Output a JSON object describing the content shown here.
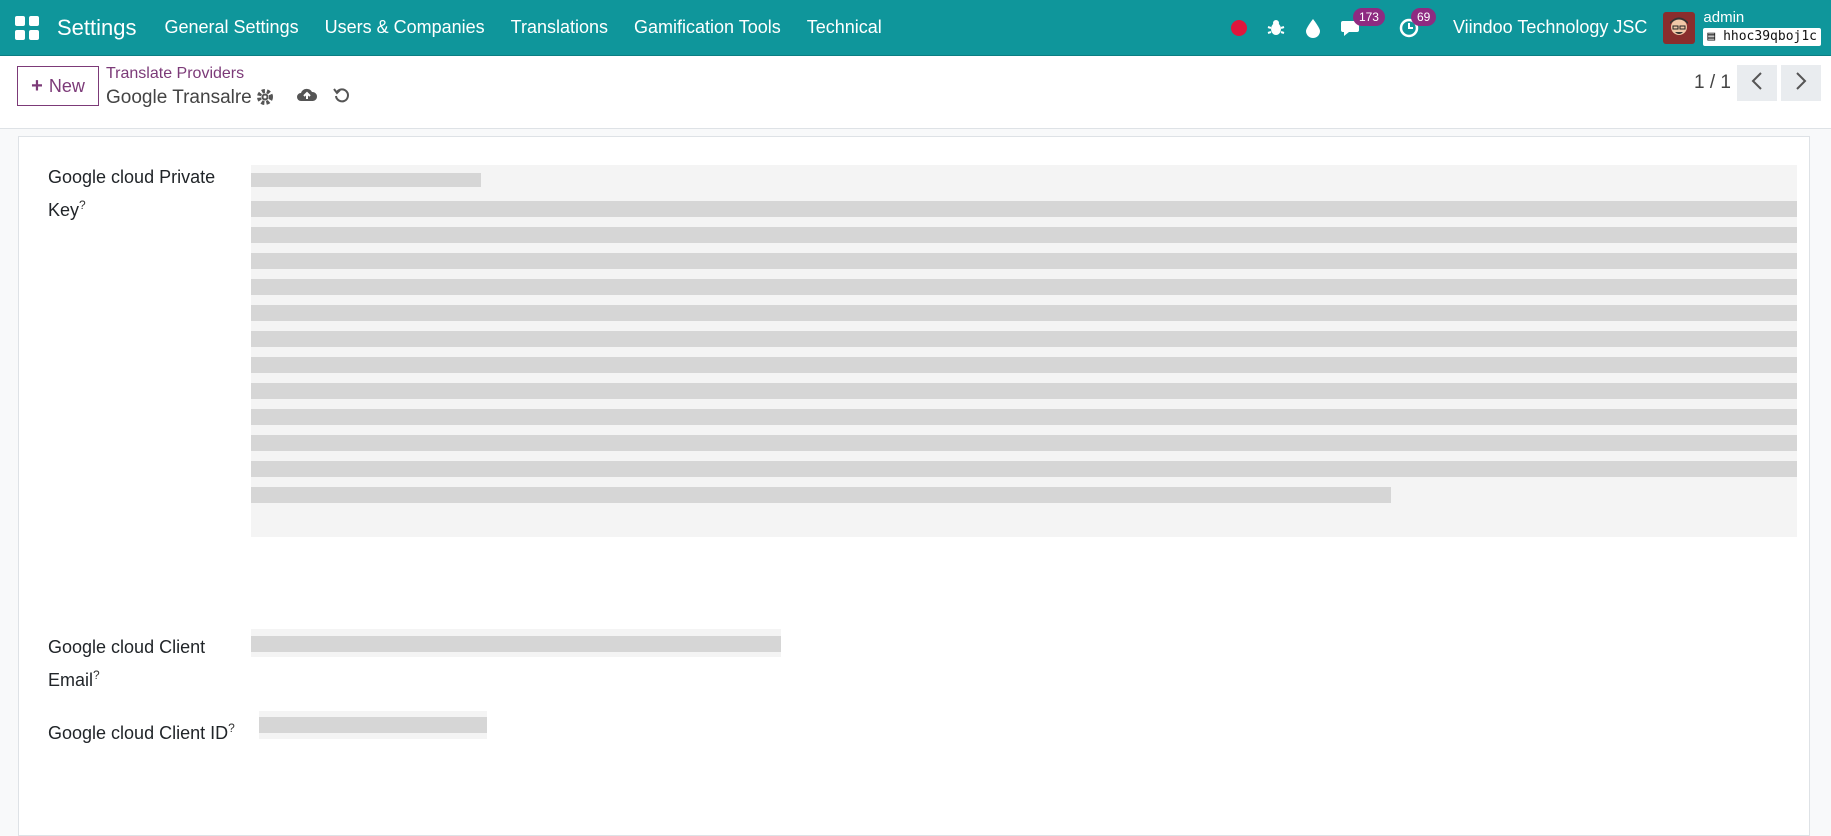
{
  "topbar": {
    "app_title": "Settings",
    "menu": [
      "General Settings",
      "Users & Companies",
      "Translations",
      "Gamification Tools",
      "Technical"
    ],
    "icons": [
      "apps-icon",
      "record-dot-icon",
      "bug-icon",
      "droplet-icon",
      "chat-icon",
      "clock-icon"
    ],
    "messages_count": "173",
    "activities_count": "69",
    "company": "Viindoo Technology JSC",
    "username": "admin",
    "database": "hhoc39qboj1c"
  },
  "control_panel": {
    "new_label": "New",
    "breadcrumb_parent": "Translate Providers",
    "breadcrumb_current": "Google Transalre",
    "pager": "1 / 1"
  },
  "form": {
    "fields": [
      {
        "label": "Google cloud Private Key",
        "tooltip": "?"
      },
      {
        "label": "Google cloud Client Email",
        "tooltip": "?"
      },
      {
        "label": "Google cloud Client ID",
        "tooltip": "?"
      }
    ]
  },
  "colors": {
    "brand": "#0f969b",
    "accent": "#7c3a78",
    "badge": "#8e2b81"
  }
}
